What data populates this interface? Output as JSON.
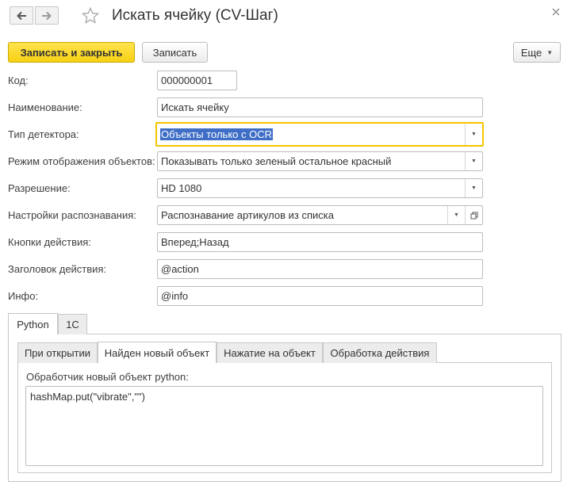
{
  "window": {
    "title": "Искать ячейку (CV-Шаг)"
  },
  "toolbar": {
    "save_close_label": "Записать и закрыть",
    "save_label": "Записать",
    "more_label": "Еще"
  },
  "form": {
    "code": {
      "label": "Код:",
      "value": "000000001"
    },
    "name": {
      "label": "Наименование:",
      "value": "Искать ячейку"
    },
    "detector_type": {
      "label": "Тип детектора:",
      "value": "Объекты только с OCR"
    },
    "display_mode": {
      "label": "Режим отображения объектов:",
      "value": "Показывать только зеленый остальное красный"
    },
    "resolution": {
      "label": "Разрешение:",
      "value": "HD 1080"
    },
    "recognition_settings": {
      "label": "Настройки распознавания:",
      "value": "Распознавание артикулов из списка"
    },
    "action_buttons": {
      "label": "Кнопки действия:",
      "value": "Вперед;Назад"
    },
    "action_title": {
      "label": "Заголовок действия:",
      "value": "@action"
    },
    "info": {
      "label": "Инфо:",
      "value": "@info"
    }
  },
  "outer_tabs": [
    {
      "label": "Python",
      "active": true
    },
    {
      "label": "1С",
      "active": false
    }
  ],
  "inner_tabs": [
    {
      "label": "При открытии",
      "active": false
    },
    {
      "label": "Найден новый объект",
      "active": true
    },
    {
      "label": "Нажатие на объект",
      "active": false
    },
    {
      "label": "Обработка действия",
      "active": false
    }
  ],
  "handler": {
    "label": "Обработчик новый объект python:",
    "code": "hashMap.put(\"vibrate\",\"\")"
  },
  "icons": {
    "back": "arrow-left-icon",
    "forward": "arrow-right-icon",
    "favorite": "star-icon",
    "close": "close-icon",
    "dropdown": "chevron-down-icon",
    "open": "open-form-icon"
  },
  "colors": {
    "primary_button": "#f7d114",
    "focus_border": "#f5c400",
    "selection": "#3f6ec6"
  }
}
